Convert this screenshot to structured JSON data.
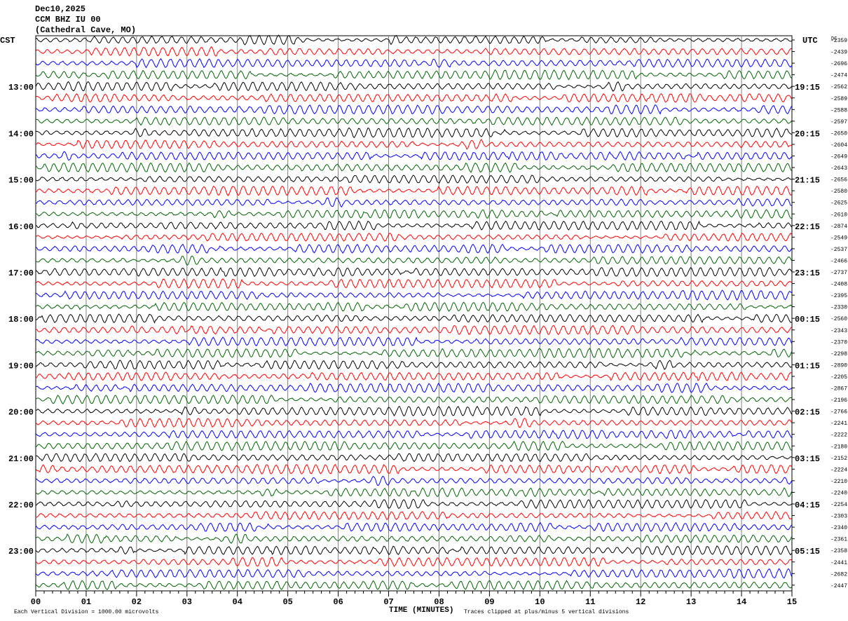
{
  "header": {
    "date": "Dec10,2025",
    "station": "CCM BHZ IU 00",
    "location": "(Cathedral Cave, MO)"
  },
  "chart_data": {
    "type": "line",
    "title": "Dec10,2025 CCM BHZ IU 00 (Cathedral Cave, MO)",
    "xlabel": "TIME (MINUTES)",
    "xlim": [
      0,
      15
    ],
    "x_ticks": [
      "00",
      "01",
      "02",
      "03",
      "04",
      "05",
      "06",
      "07",
      "08",
      "09",
      "10",
      "11",
      "12",
      "13",
      "14",
      "15"
    ],
    "left_axis_title": "CST",
    "right_axis_title": "UTC",
    "dc_header": "DC",
    "left_labels": [
      {
        "row": 4,
        "text": "13:00"
      },
      {
        "row": 8,
        "text": "14:00"
      },
      {
        "row": 12,
        "text": "15:00"
      },
      {
        "row": 16,
        "text": "16:00"
      },
      {
        "row": 20,
        "text": "17:00"
      },
      {
        "row": 24,
        "text": "18:00"
      },
      {
        "row": 28,
        "text": "19:00"
      },
      {
        "row": 32,
        "text": "20:00"
      },
      {
        "row": 36,
        "text": "21:00"
      },
      {
        "row": 40,
        "text": "22:00"
      },
      {
        "row": 44,
        "text": "23:00"
      }
    ],
    "right_labels": [
      {
        "row": 4,
        "text": "19:15"
      },
      {
        "row": 8,
        "text": "20:15"
      },
      {
        "row": 12,
        "text": "21:15"
      },
      {
        "row": 16,
        "text": "22:15"
      },
      {
        "row": 20,
        "text": "23:15"
      },
      {
        "row": 24,
        "text": "00:15"
      },
      {
        "row": 28,
        "text": "01:15"
      },
      {
        "row": 32,
        "text": "02:15"
      },
      {
        "row": 36,
        "text": "03:15"
      },
      {
        "row": 40,
        "text": "04:15"
      },
      {
        "row": 44,
        "text": "05:15"
      }
    ],
    "dc_offsets": [
      -2359,
      -2439,
      -2696,
      -2474,
      -2562,
      -2589,
      -2588,
      -2597,
      -2650,
      -2604,
      -2649,
      -2643,
      -2656,
      -2580,
      -2625,
      -2610,
      -2874,
      -2549,
      -2537,
      -2466,
      -2737,
      -2408,
      -2395,
      -2330,
      -2560,
      -2343,
      -2370,
      -2298,
      -2890,
      -2205,
      -2867,
      -2196,
      -2766,
      -2241,
      -2222,
      -2180,
      -2152,
      -2224,
      -2210,
      -2240,
      -2254,
      -2303,
      -2340,
      -2361,
      -2358,
      -2441,
      -2682,
      -2447
    ],
    "trace_colors": [
      "#000000",
      "#ff0000",
      "#0000ff",
      "#006400"
    ],
    "grid_color": "#808080",
    "vertical_grid": true,
    "scale_note": "Each Vertical Division = 1000.00 microvolts",
    "clip_note": "Traces clipped at plus/minus 5 vertical divisions"
  }
}
